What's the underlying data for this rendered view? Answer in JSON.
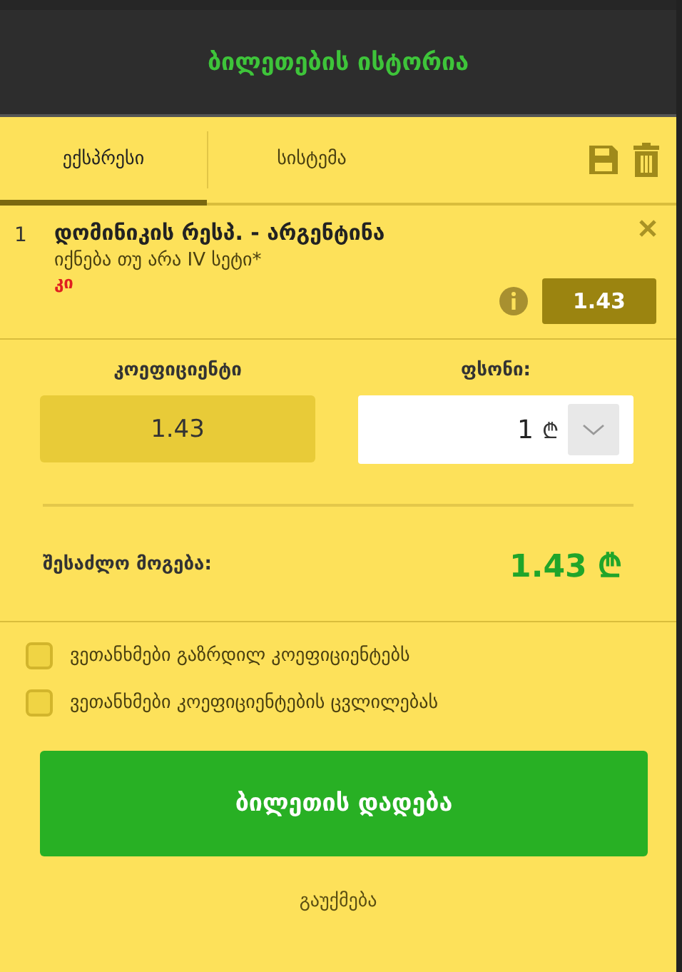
{
  "header": {
    "title": "ბილეთების ისტორია"
  },
  "tabs": [
    {
      "label": "ექსპრესი",
      "selected": true
    },
    {
      "label": "სისტემა",
      "selected": false
    }
  ],
  "bets": [
    {
      "number": "1",
      "match": "დომინიკის რესპ. - არგენტინა",
      "market": "იქნება თუ არა IV სეტი*",
      "pick": "კი",
      "odds": "1.43"
    }
  ],
  "odds_box": {
    "label": "კოეფიციენტი",
    "value": "1.43"
  },
  "stake": {
    "label": "ფსონი:",
    "value": "1",
    "currency": "₾"
  },
  "possible_win": {
    "label": "შესაძლო მოგება:",
    "value": "1.43 ₾"
  },
  "options": [
    {
      "label": "ვეთანხმები გაზრდილ კოეფიციენტებს",
      "checked": false
    },
    {
      "label": "ვეთანხმები კოეფიციენტების ცვლილებას",
      "checked": false
    }
  ],
  "place_button": "ბილეთის დადება",
  "cancel": "გაუქმება"
}
